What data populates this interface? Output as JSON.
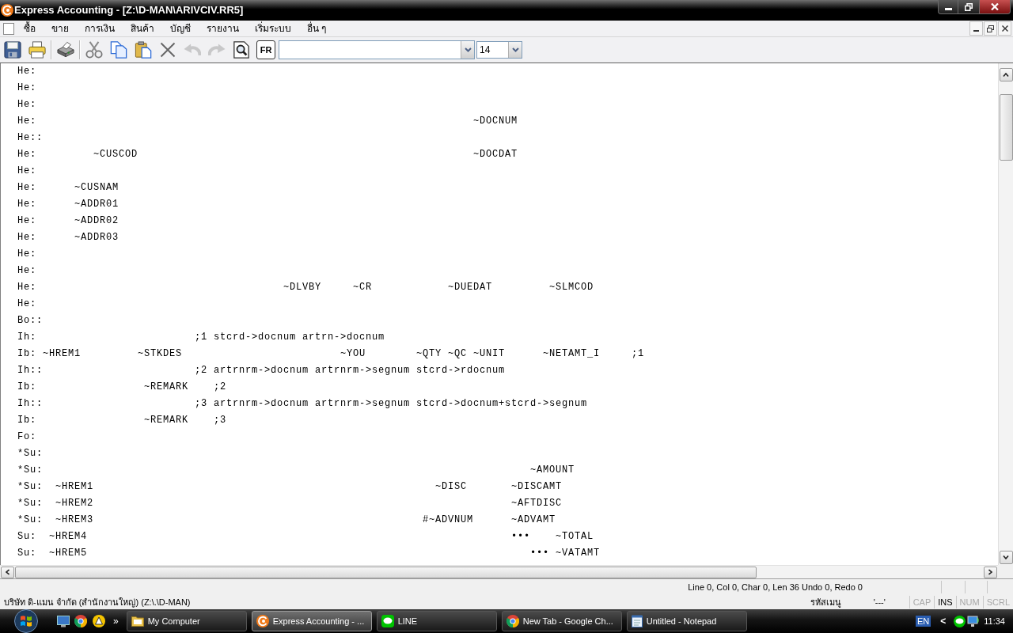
{
  "window": {
    "title": "Express Accounting - [Z:\\D-MAN\\ARIVCIV.RR5]"
  },
  "menu": [
    "ซื้อ",
    "ขาย",
    "การเงิน",
    "สินค้า",
    "บัญชี",
    "รายงาน",
    "เริ่มระบบ",
    "อื่น ๆ"
  ],
  "toolbar": {
    "buttons": [
      {
        "kind": "save",
        "disabled": false
      },
      {
        "kind": "print",
        "disabled": false
      },
      {
        "kind": "separator"
      },
      {
        "kind": "printer",
        "disabled": false
      },
      {
        "kind": "separator"
      },
      {
        "kind": "cut",
        "disabled": false
      },
      {
        "kind": "copy",
        "disabled": false
      },
      {
        "kind": "paste",
        "disabled": false
      },
      {
        "kind": "delete",
        "disabled": false
      },
      {
        "kind": "undo",
        "disabled": true
      },
      {
        "kind": "redo",
        "disabled": true
      },
      {
        "kind": "find",
        "disabled": false
      },
      {
        "kind": "replace",
        "label": "FR",
        "disabled": false
      }
    ],
    "font_size": {
      "value": "14"
    }
  },
  "editor": {
    "lines": [
      "He:",
      "He:",
      "He:",
      "He:                                                                     ~DOCNUM",
      "He::",
      "He:         ~CUSCOD                                                     ~DOCDAT",
      "He:",
      "He:      ~CUSNAM",
      "He:      ~ADDR01",
      "He:      ~ADDR02",
      "He:      ~ADDR03",
      "He:",
      "He:",
      "He:                                       ~DLVBY     ~CR            ~DUEDAT         ~SLMCOD",
      "He:",
      "Bo::",
      "Ih:                         ;1 stcrd->docnum artrn->docnum",
      "Ib: ~HREM1         ~STKDES                         ~YOU        ~QTY ~QC ~UNIT      ~NETAMT_I     ;1",
      "Ih::                        ;2 artrnrm->docnum artrnrm->segnum stcrd->rdocnum",
      "Ib:                 ~REMARK    ;2",
      "Ih::                        ;3 artrnrm->docnum artrnrm->segnum stcrd->docnum+stcrd->segnum",
      "Ib:                 ~REMARK    ;3",
      "Fo:",
      "*Su:",
      "*Su:                                                                             ~AMOUNT",
      "*Su:  ~HREM1                                                      ~DISC       ~DISCAMT",
      "*Su:  ~HREM2                                                                  ~AFTDISC",
      "*Su:  ~HREM3                                                    #~ADVNUM      ~ADVAMT",
      "Su:  ~HREM4                                                                   •••    ~TOTAL",
      "Su:  ~HREM5                                                                      ••• ~VATAMT"
    ]
  },
  "status_bar": {
    "position": "Line 0, Col 0, Char 0, Len 36 Undo 0, Redo 0",
    "company": "บริษัท ดิ-แมน จำกัด (สำนักงานใหญ่) (Z:\\.\\D-MAN)",
    "menu_code_label": "รหัสเมนู",
    "menu_code": "'---'",
    "indicators": [
      {
        "label": "CAP",
        "on": false
      },
      {
        "label": "INS",
        "on": true
      },
      {
        "label": "NUM",
        "on": false
      },
      {
        "label": "SCRL",
        "on": false
      }
    ]
  },
  "taskbar": {
    "overflow": "»",
    "buttons": [
      {
        "kind": "folder",
        "label": "My Computer",
        "selected": false
      },
      {
        "kind": "express",
        "label": "Express Accounting - ...",
        "selected": true
      },
      {
        "kind": "line",
        "label": "LINE",
        "selected": false
      },
      {
        "kind": "chrome",
        "label": "New Tab - Google Ch...",
        "selected": false
      },
      {
        "kind": "notepad",
        "label": "Untitled - Notepad",
        "selected": false
      }
    ],
    "tray": {
      "language": "EN",
      "expander": "<",
      "time": "11:34"
    }
  }
}
